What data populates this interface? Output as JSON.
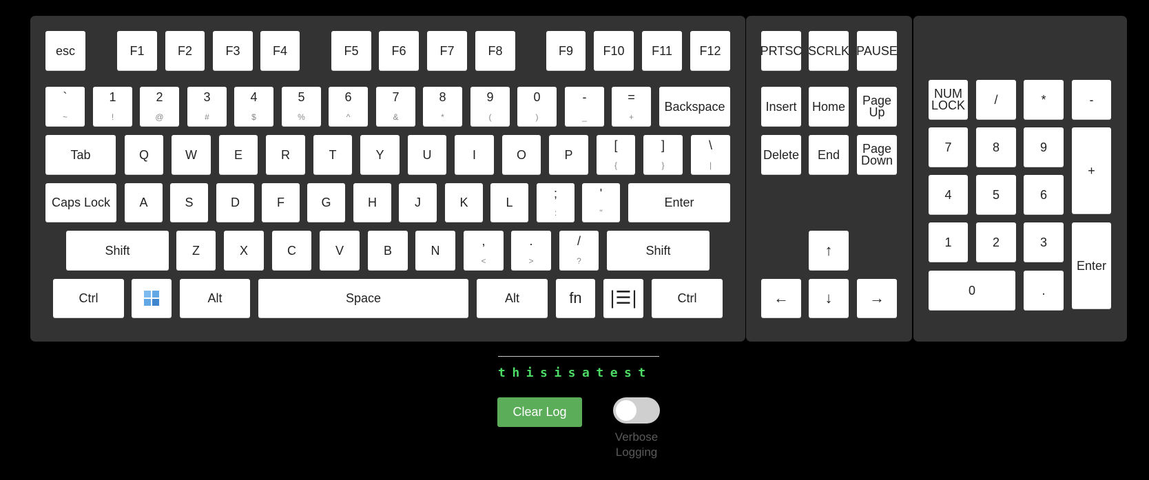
{
  "colors": {
    "page_background": "#000000",
    "panel_background": "#333333",
    "key_background": "#ffffff",
    "key_text": "#222222",
    "key_secondary_text": "#888888",
    "log_text": "#4cd964",
    "clear_button": "#5cad5a",
    "toggle_off": "#cfcfcf"
  },
  "keys": {
    "esc": "esc",
    "f1": "F1",
    "f2": "F2",
    "f3": "F3",
    "f4": "F4",
    "f5": "F5",
    "f6": "F6",
    "f7": "F7",
    "f8": "F8",
    "f9": "F9",
    "f10": "F10",
    "f11": "F11",
    "f12": "F12",
    "prtsc": "PRTSC",
    "scrlk": "SCRLK",
    "pause": "PAUSE",
    "backtick": "`",
    "tilde": "~",
    "digit_1": "1",
    "shift_1": "!",
    "digit_2": "2",
    "shift_2": "@",
    "digit_3": "3",
    "shift_3": "#",
    "digit_4": "4",
    "shift_4": "$",
    "digit_5": "5",
    "shift_5": "%",
    "digit_6": "6",
    "shift_6": "^",
    "digit_7": "7",
    "shift_7": "&",
    "digit_8": "8",
    "shift_8": "*",
    "digit_9": "9",
    "shift_9": "(",
    "digit_0": "0",
    "shift_0": ")",
    "minus": "-",
    "underscore": "_",
    "equals": "=",
    "plus": "+",
    "backspace": "Backspace",
    "insert": "Insert",
    "home": "Home",
    "page_up": "Page Up",
    "tab": "Tab",
    "q": "Q",
    "w": "W",
    "e": "E",
    "r": "R",
    "t": "T",
    "y": "Y",
    "u": "U",
    "i": "I",
    "o": "O",
    "p": "P",
    "lbracket": "[",
    "lbrace": "{",
    "rbracket": "]",
    "rbrace": "}",
    "backslash": "\\",
    "pipe": "|",
    "delete": "Delete",
    "end": "End",
    "page_down": "Page Down",
    "caps_lock": "Caps Lock",
    "a": "A",
    "s": "S",
    "d": "D",
    "f": "F",
    "g": "G",
    "h": "H",
    "j": "J",
    "k": "K",
    "l": "L",
    "semicolon": ";",
    "colon": ":",
    "quote": "'",
    "dquote": "\"",
    "enter": "Enter",
    "shift_left": "Shift",
    "z": "Z",
    "x": "X",
    "c": "C",
    "v": "V",
    "b": "B",
    "n": "N",
    "comma": ",",
    "less": "<",
    "period": ".",
    "greater": ">",
    "slash": "/",
    "question": "?",
    "shift_right": "Shift",
    "ctrl_left": "Ctrl",
    "alt_left": "Alt",
    "space": "Space",
    "alt_right": "Alt",
    "fn": "fn",
    "ctrl_right": "Ctrl",
    "arrow_up": "↑",
    "arrow_left": "←",
    "arrow_down": "↓",
    "arrow_right": "→",
    "num_lock": "NUM LOCK",
    "num_divide": "/",
    "num_multiply": "*",
    "num_subtract": "-",
    "num_7": "7",
    "num_8": "8",
    "num_9": "9",
    "num_add": "+",
    "num_4": "4",
    "num_5": "5",
    "num_6": "6",
    "num_1": "1",
    "num_2": "2",
    "num_3": "3",
    "num_enter": "Enter",
    "num_0": "0",
    "num_decimal": "."
  },
  "icons": {
    "windows_key": "windows-logo-icon",
    "menu_key": "context-menu-icon"
  },
  "log": {
    "text": "thisisatest"
  },
  "controls": {
    "clear_log_label": "Clear Log",
    "verbose_label": "Verbose Logging",
    "verbose_enabled": false
  }
}
